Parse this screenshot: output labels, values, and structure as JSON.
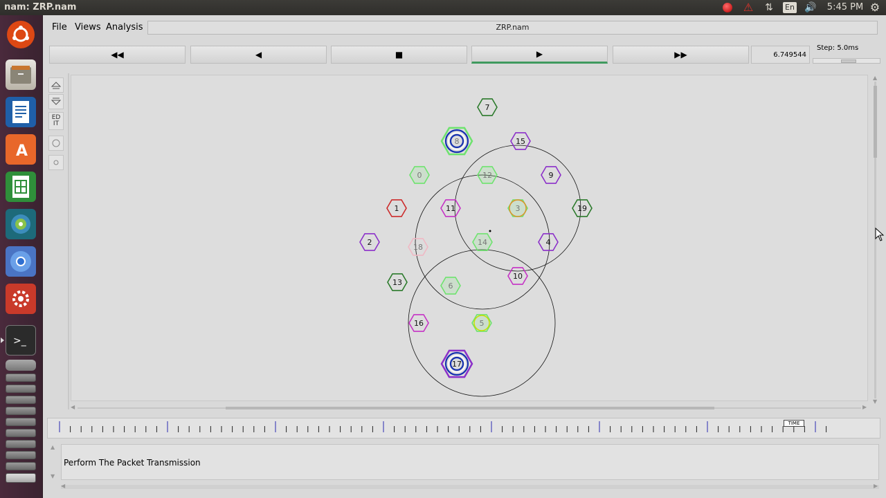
{
  "window": {
    "title": "nam: ZRP.nam",
    "file": "ZRP.nam"
  },
  "topbar": {
    "clock": "5:45 PM",
    "lang": "En"
  },
  "menus": [
    {
      "label": "File"
    },
    {
      "label": "Views"
    },
    {
      "label": "Analysis"
    }
  ],
  "controls": {
    "rewind": "◀◀",
    "back": "◀",
    "stop": "■",
    "play": "▶",
    "ffwd": "▶▶",
    "time": "6.749544",
    "step": "Step: 5.0ms",
    "active": "play"
  },
  "tools": {
    "edit": "ED\nIT"
  },
  "colors": {
    "green": "#2b7a2b",
    "purple": "#8b2fc9",
    "magenta": "#c532c5",
    "red": "#cc2a2a",
    "lightgreen": "#6ee36e",
    "pink": "#f0b8c4",
    "blue": "#1530b0",
    "orange": "#e0902a"
  },
  "nodes": [
    {
      "label": "0",
      "color": "lightgreen"
    },
    {
      "label": "1",
      "color": "red"
    },
    {
      "label": "2",
      "color": "purple"
    },
    {
      "label": "3",
      "color": "lightgreen"
    },
    {
      "label": "4",
      "color": "purple"
    },
    {
      "label": "5",
      "color": "lightgreen"
    },
    {
      "label": "6",
      "color": "lightgreen"
    },
    {
      "label": "7",
      "color": "green"
    },
    {
      "label": "8",
      "color": "lightgreen"
    },
    {
      "label": "9",
      "color": "purple"
    },
    {
      "label": "10",
      "color": "magenta"
    },
    {
      "label": "11",
      "color": "magenta"
    },
    {
      "label": "12",
      "color": "lightgreen"
    },
    {
      "label": "13",
      "color": "green"
    },
    {
      "label": "14",
      "color": "lightgreen"
    },
    {
      "label": "15",
      "color": "purple"
    },
    {
      "label": "16",
      "color": "magenta"
    },
    {
      "label": "17",
      "color": "purple"
    },
    {
      "label": "18",
      "color": "pink"
    },
    {
      "label": "19",
      "color": "green"
    }
  ],
  "timeline": {
    "marker": "TIME"
  },
  "annotation": {
    "text": "Perform The Packet Transmission"
  }
}
